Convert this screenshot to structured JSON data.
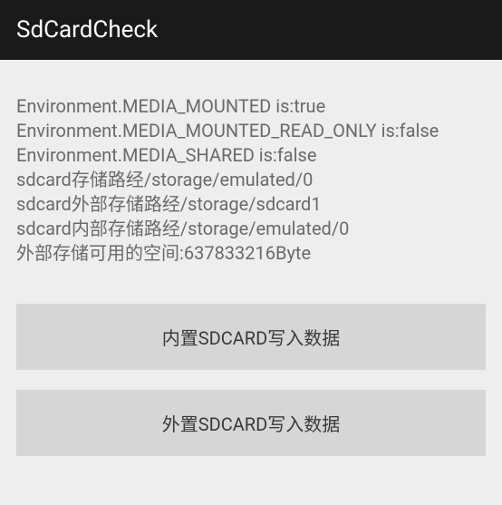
{
  "header": {
    "title": "SdCardCheck"
  },
  "info": {
    "line1": "Environment.MEDIA_MOUNTED is:true",
    "line2": "Environment.MEDIA_MOUNTED_READ_ONLY is:false",
    "line3": "Environment.MEDIA_SHARED is:false",
    "line4": "sdcard存储路经/storage/emulated/0",
    "line5": "sdcard外部存储路经/storage/sdcard1",
    "line6": "sdcard内部存储路经/storage/emulated/0",
    "line7": "外部存储可用的空间:637833216Byte"
  },
  "buttons": {
    "internal_label": "内置SDCARD写入数据",
    "external_label": "外置SDCARD写入数据"
  }
}
